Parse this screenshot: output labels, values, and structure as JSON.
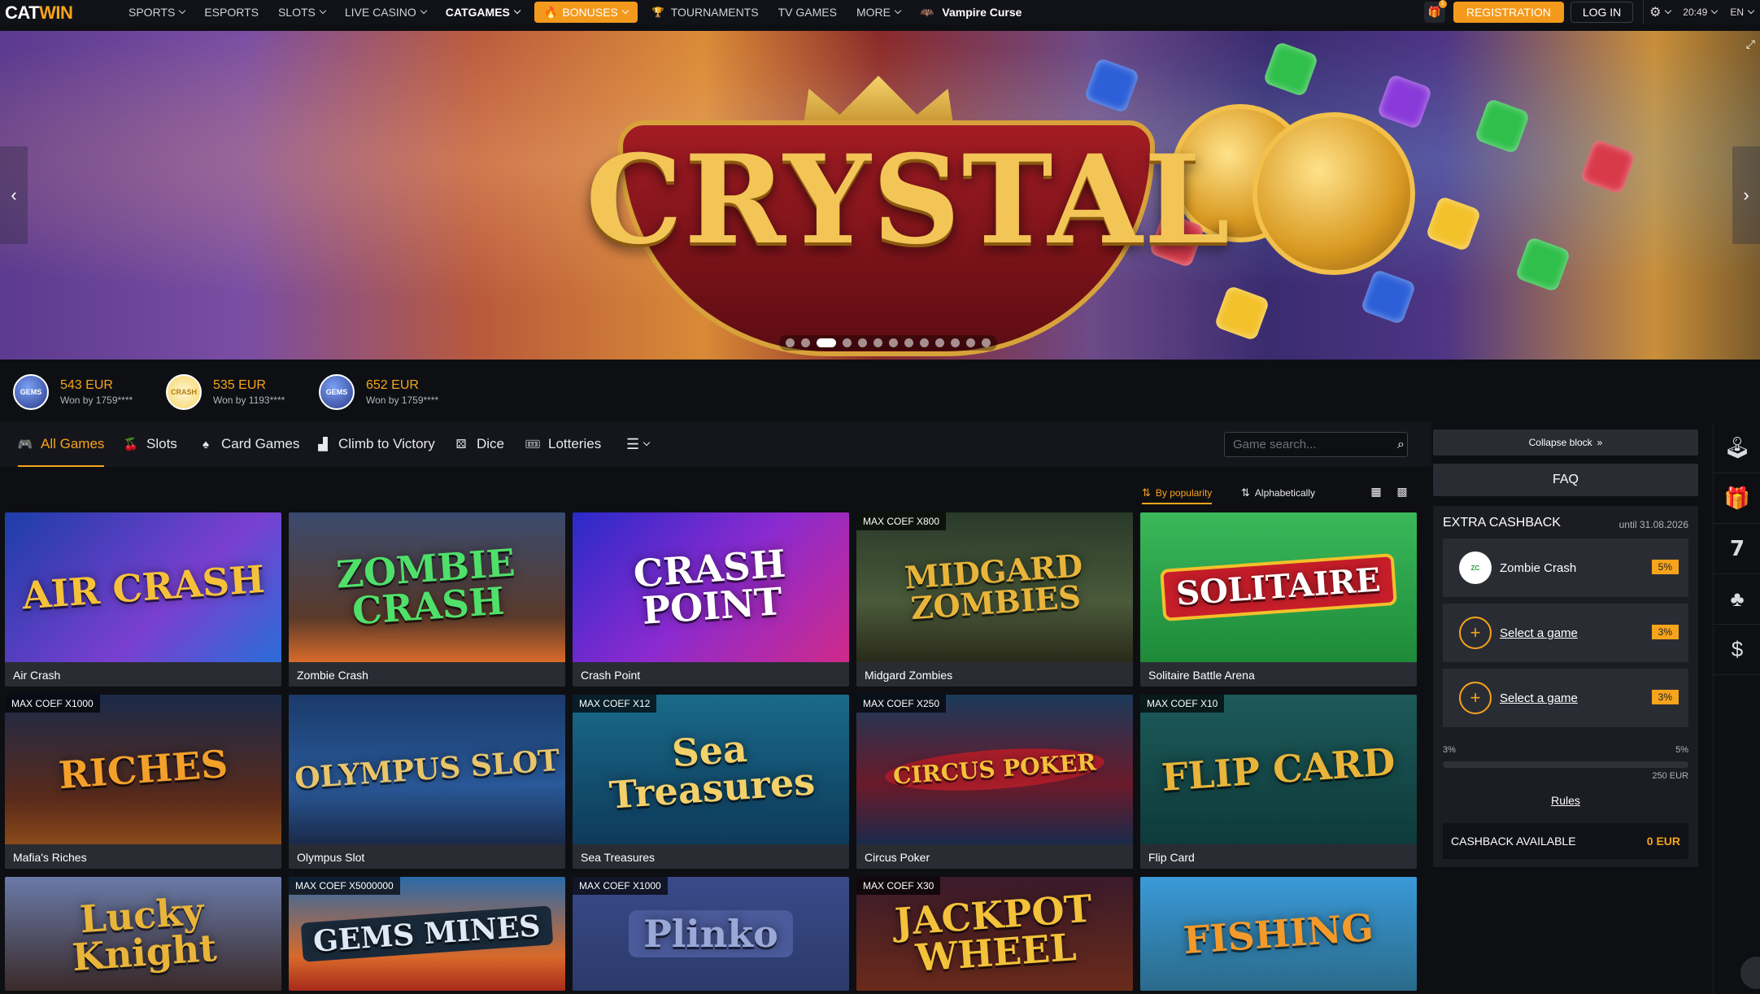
{
  "header": {
    "logo_cat": "CAT",
    "logo_win": "WIN",
    "nav": [
      {
        "label": "SPORTS",
        "caret": true
      },
      {
        "label": "ESPORTS",
        "caret": false
      },
      {
        "label": "SLOTS",
        "caret": true
      },
      {
        "label": "LIVE CASINO",
        "caret": true
      },
      {
        "label": "CATGAMES",
        "caret": true
      },
      {
        "label": "BONUSES",
        "caret": true
      },
      {
        "label": "TOURNAMENTS",
        "caret": false
      },
      {
        "label": "TV GAMES",
        "caret": false
      },
      {
        "label": "MORE",
        "caret": true
      },
      {
        "label": "Vampire Curse",
        "caret": false
      }
    ],
    "gift_count": "1",
    "registration": "REGISTRATION",
    "login": "LOG IN",
    "time": "20:49",
    "lang": "EN"
  },
  "banner": {
    "title": "CRYSTAL",
    "slide_count": 13,
    "active_slide": 2
  },
  "winners": [
    {
      "amount": "543 EUR",
      "by": "Won by 1759****",
      "avatar": "GEMS"
    },
    {
      "amount": "535 EUR",
      "by": "Won by 1193****",
      "avatar": "CRASH"
    },
    {
      "amount": "652 EUR",
      "by": "Won by 1759****",
      "avatar": "GEMS"
    }
  ],
  "categories": {
    "items": [
      {
        "label": "All Games",
        "active": true
      },
      {
        "label": "Slots",
        "active": false
      },
      {
        "label": "Card Games",
        "active": false
      },
      {
        "label": "Climb to Victory",
        "active": false
      },
      {
        "label": "Dice",
        "active": false
      },
      {
        "label": "Lotteries",
        "active": false
      }
    ],
    "search_placeholder": "Game search..."
  },
  "sort": {
    "popularity": "By popularity",
    "alphabetical": "Alphabetically"
  },
  "games": [
    {
      "title": "Air Crash",
      "art": "AIR CRASH",
      "badge": ""
    },
    {
      "title": "Zombie Crash",
      "art": "ZOMBIE CRASH",
      "badge": ""
    },
    {
      "title": "Crash Point",
      "art": "CRASH POINT",
      "badge": ""
    },
    {
      "title": "Midgard Zombies",
      "art": "MIDGARD ZOMBIES",
      "badge": "MAX COEF X800"
    },
    {
      "title": "Solitaire Battle Arena",
      "art": "SOLITAIRE",
      "badge": ""
    },
    {
      "title": "Mafia's Riches",
      "art": "RICHES",
      "badge": "MAX COEF X1000"
    },
    {
      "title": "Olympus Slot",
      "art": "OLYMPUS SLOT",
      "badge": ""
    },
    {
      "title": "Sea Treasures",
      "art": "Sea Treasures",
      "badge": "MAX COEF X12"
    },
    {
      "title": "Circus Poker",
      "art": "CIRCUS POKER",
      "badge": "MAX COEF X250"
    },
    {
      "title": "Flip Card",
      "art": "FLIP CARD",
      "badge": "MAX COEF X10"
    },
    {
      "title": "",
      "art": "Lucky Knight",
      "badge": ""
    },
    {
      "title": "",
      "art": "GEMS MINES",
      "badge": "MAX COEF X5000000"
    },
    {
      "title": "",
      "art": "Plinko",
      "badge": "MAX COEF X1000"
    },
    {
      "title": "",
      "art": "JACKPOT WHEEL",
      "badge": "MAX COEF X30"
    },
    {
      "title": "",
      "art": "FISHING",
      "badge": ""
    }
  ],
  "panel": {
    "collapse": "Collapse block",
    "faq": "FAQ",
    "cashback_title": "EXTRA CASHBACK",
    "until": "until 31.08.2026",
    "rows": [
      {
        "name": "Zombie Crash",
        "pct": "5%",
        "type": "game"
      },
      {
        "name": "Select a game",
        "pct": "3%",
        "type": "select"
      },
      {
        "name": "Select a game",
        "pct": "3%",
        "type": "select"
      }
    ],
    "scale_low": "3%",
    "scale_high": "5%",
    "progress": 0,
    "threshold": "250 EUR",
    "rules": "Rules",
    "available_label": "CASHBACK AVAILABLE",
    "available_value": "0 EUR"
  },
  "colors": {
    "accent": "#f6a41b",
    "background": "#0e0f13",
    "card": "#2a2c34"
  }
}
